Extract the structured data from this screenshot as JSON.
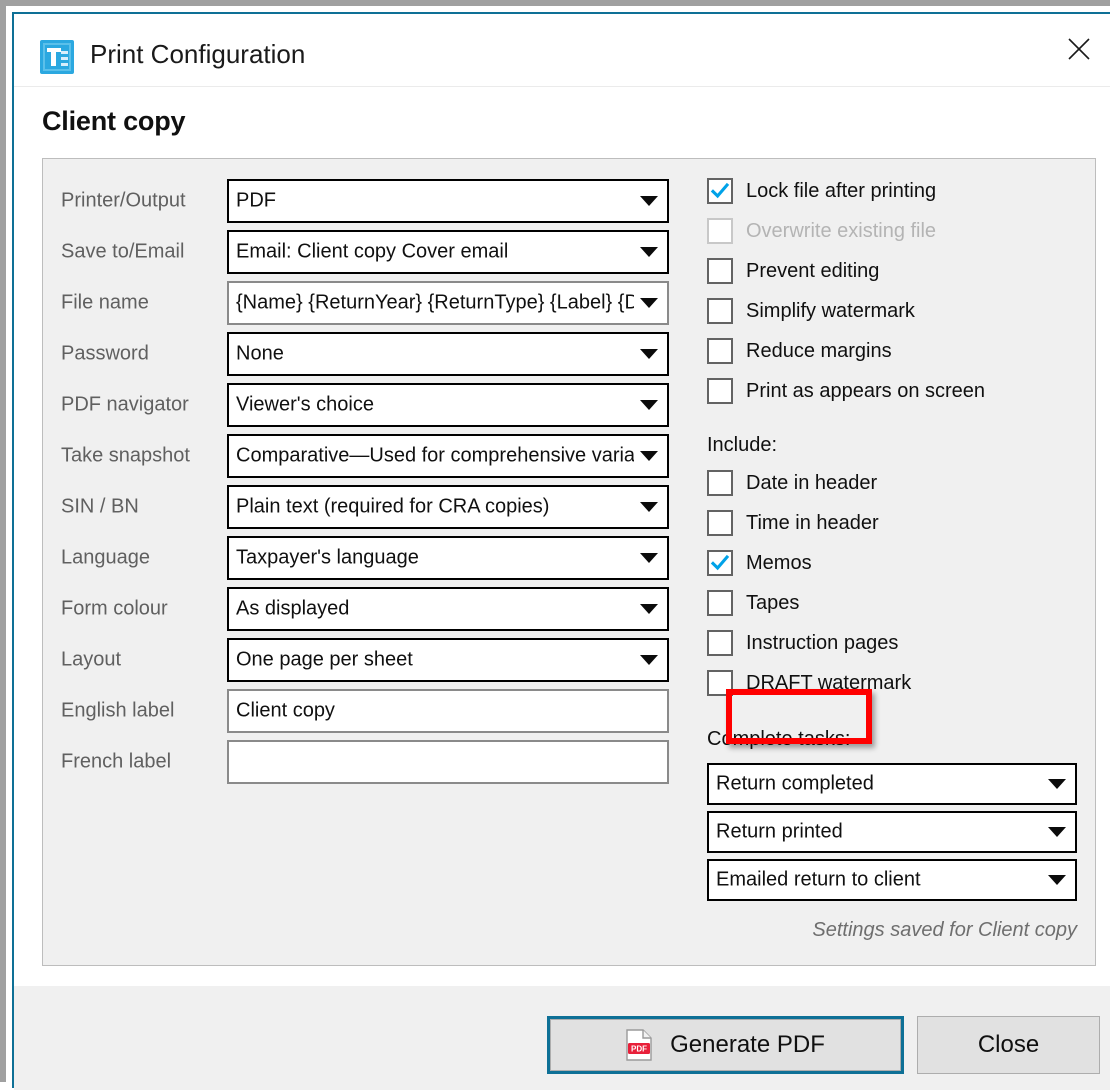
{
  "window": {
    "title": "Print Configuration",
    "app_icon": "tax-app-icon",
    "close_icon": "close-icon"
  },
  "heading": "Client copy",
  "form": {
    "rows": [
      {
        "label": "Printer/Output",
        "value": "PDF",
        "type": "select",
        "style": "black"
      },
      {
        "label": "Save to/Email",
        "value": "Email: Client copy Cover email",
        "type": "select",
        "style": "black"
      },
      {
        "label": "File name",
        "value": "{Name} {ReturnYear} {ReturnType} {Label} {Dɑ",
        "type": "select",
        "style": "gray"
      },
      {
        "label": "Password",
        "value": "None",
        "type": "select",
        "style": "black"
      },
      {
        "label": "PDF navigator",
        "value": "Viewer's choice",
        "type": "select",
        "style": "black"
      },
      {
        "label": "Take snapshot",
        "value": "Comparative—Used for comprehensive varia",
        "type": "select",
        "style": "black"
      },
      {
        "label": "SIN / BN",
        "value": "Plain text (required for CRA copies)",
        "type": "select",
        "style": "black"
      },
      {
        "label": "Language",
        "value": "Taxpayer's language",
        "type": "select",
        "style": "black"
      },
      {
        "label": "Form colour",
        "value": "As displayed",
        "type": "select",
        "style": "black"
      },
      {
        "label": "Layout",
        "value": "One page per sheet",
        "type": "select",
        "style": "black"
      },
      {
        "label": "English label",
        "value": "Client copy",
        "type": "text",
        "style": "gray"
      },
      {
        "label": "French label",
        "value": "",
        "type": "text",
        "style": "gray"
      }
    ]
  },
  "options": {
    "checkboxes": [
      {
        "label": "Lock file after printing",
        "checked": true,
        "disabled": false
      },
      {
        "label": "Overwrite existing file",
        "checked": false,
        "disabled": true
      },
      {
        "label": "Prevent editing",
        "checked": false,
        "disabled": false
      },
      {
        "label": "Simplify watermark",
        "checked": false,
        "disabled": false
      },
      {
        "label": "Reduce margins",
        "checked": false,
        "disabled": false
      },
      {
        "label": "Print as appears on screen",
        "checked": false,
        "disabled": false
      }
    ]
  },
  "include": {
    "title": "Include:",
    "checkboxes": [
      {
        "label": "Date in header",
        "checked": false,
        "disabled": false
      },
      {
        "label": "Time in header",
        "checked": false,
        "disabled": false
      },
      {
        "label": "Memos",
        "checked": true,
        "disabled": false,
        "highlighted": true
      },
      {
        "label": "Tapes",
        "checked": false,
        "disabled": false
      },
      {
        "label": "Instruction pages",
        "checked": false,
        "disabled": false
      },
      {
        "label": "DRAFT watermark",
        "checked": false,
        "disabled": false
      }
    ]
  },
  "tasks": {
    "title": "Complete tasks:",
    "selects": [
      {
        "value": "Return completed"
      },
      {
        "value": "Return printed"
      },
      {
        "value": "Emailed return to client"
      }
    ],
    "saved_note": "Settings saved for Client copy"
  },
  "footer": {
    "generate_label": "Generate PDF",
    "generate_icon": "pdf-file-icon",
    "close_label": "Close"
  },
  "colors": {
    "accent": "#0e7096",
    "checkmark": "#00a2e8",
    "highlight": "#ff0000",
    "panel_bg": "#f0f0f0",
    "label_text": "#606060"
  }
}
